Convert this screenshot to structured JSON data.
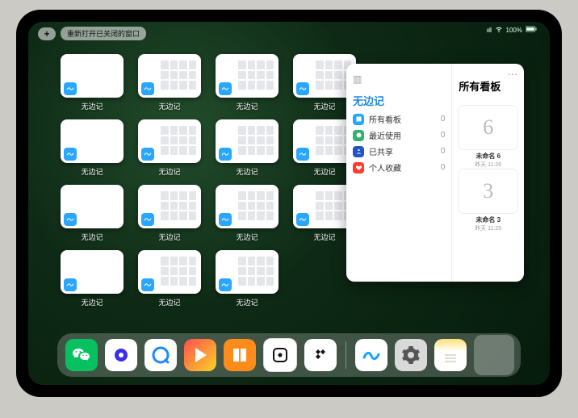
{
  "topbar": {
    "plus_label": "+",
    "reopen_label": "重新打开已关闭的窗口"
  },
  "status": {
    "signal": "ııll",
    "wifi": "major",
    "battery_text": "100%"
  },
  "app": {
    "label": "无边记"
  },
  "popup": {
    "left_title": "无边记",
    "right_title": "所有看板",
    "nav": [
      {
        "label": "所有看板",
        "count": 0,
        "color": "#1fa8ff"
      },
      {
        "label": "最近使用",
        "count": 0,
        "color": "#2fb36d"
      },
      {
        "label": "已共享",
        "count": 0,
        "color": "#2254c9"
      },
      {
        "label": "个人收藏",
        "count": 0,
        "color": "#ff3b30"
      }
    ],
    "boards": [
      {
        "sketch": "6",
        "title": "未命名 6",
        "subtitle": "昨天 11:26"
      },
      {
        "sketch": "3",
        "title": "未命名 3",
        "subtitle": "昨天 11:25"
      }
    ]
  },
  "dock": {
    "items": [
      "wechat",
      "quark",
      "qq-browser",
      "app-store",
      "books",
      "dice",
      "tidal",
      "freeform",
      "settings",
      "notes",
      "app-library"
    ]
  }
}
